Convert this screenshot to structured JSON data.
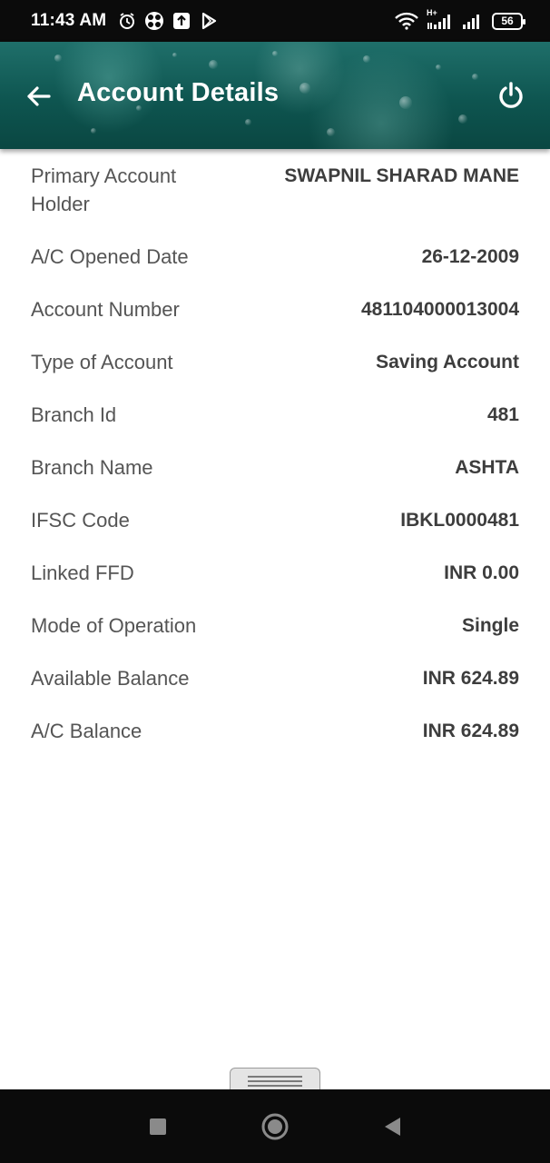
{
  "status_bar": {
    "time": "11:43 AM",
    "icons_left": [
      "alarm-icon",
      "app-notification-icon",
      "upload-icon",
      "play-store-icon"
    ],
    "icons_right": [
      "wifi-icon",
      "signal-icon-1",
      "signal-icon-2"
    ],
    "battery": "56",
    "network_label": "H+"
  },
  "app_bar": {
    "title": "Account Details",
    "back_icon": "arrow-left-icon",
    "power_icon": "power-icon",
    "color": "#0e5550"
  },
  "details": [
    {
      "label": "Primary Account Holder",
      "value": "SWAPNIL SHARAD MANE"
    },
    {
      "label": "A/C Opened Date",
      "value": "26-12-2009"
    },
    {
      "label": "Account Number",
      "value": "481104000013004"
    },
    {
      "label": "Type of Account",
      "value": "Saving Account"
    },
    {
      "label": "Branch Id",
      "value": "481"
    },
    {
      "label": "Branch Name",
      "value": "ASHTA"
    },
    {
      "label": "IFSC Code",
      "value": "IBKL0000481"
    },
    {
      "label": "Linked FFD",
      "value": "INR 0.00"
    },
    {
      "label": "Mode of Operation",
      "value": "Single"
    },
    {
      "label": "Available Balance",
      "value": "INR 624.89"
    },
    {
      "label": "A/C Balance",
      "value": "INR 624.89"
    }
  ],
  "nav_bar": {
    "recents": "square-recents-icon",
    "home": "circle-home-icon",
    "back": "triangle-back-icon"
  }
}
